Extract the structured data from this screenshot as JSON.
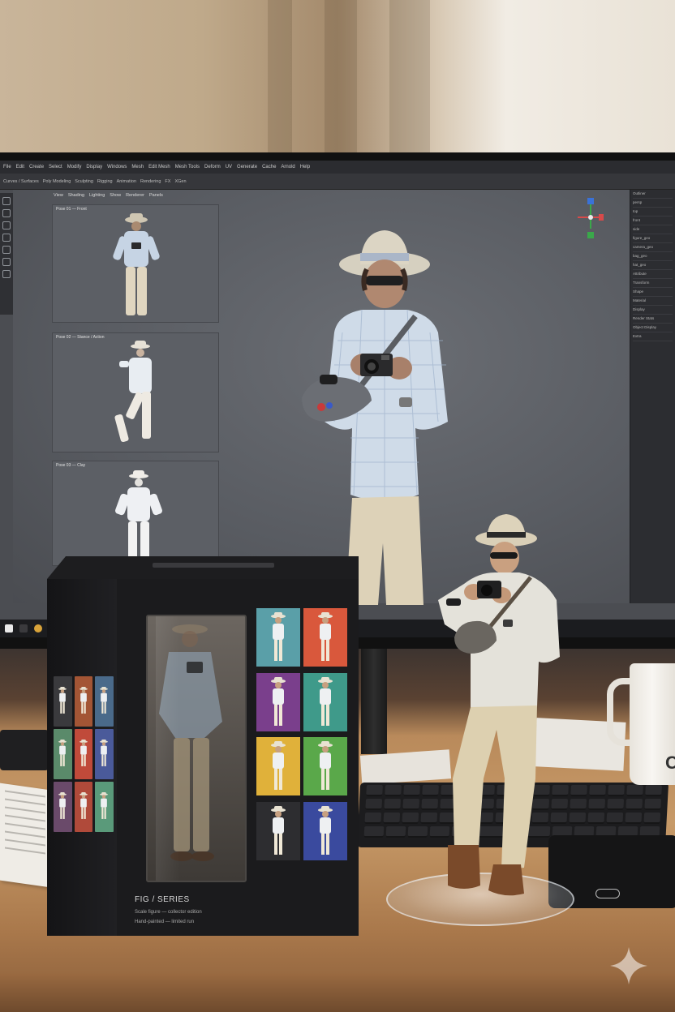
{
  "scene": {
    "description_kind": "photo",
    "mug_text": "C"
  },
  "monitor": {
    "menubar_items": [
      "File",
      "Edit",
      "Create",
      "Select",
      "Modify",
      "Display",
      "Windows",
      "Mesh",
      "Edit Mesh",
      "Mesh Tools",
      "Deform",
      "UV",
      "Generate",
      "Cache",
      "Arnold",
      "Help"
    ],
    "toolbar_items": [
      "Curves / Surfaces",
      "Poly Modeling",
      "Sculpting",
      "Rigging",
      "Animation",
      "Rendering",
      "FX",
      "XGen"
    ],
    "viewport_header": [
      "View",
      "Shading",
      "Lighting",
      "Show",
      "Renderer",
      "Panels"
    ],
    "thumbnails": [
      {
        "label": "Pose 01 — Front"
      },
      {
        "label": "Pose 02 — Stance / Action"
      },
      {
        "label": "Pose 03 — Clay"
      }
    ],
    "right_panel_rows": [
      "Outliner",
      "persp",
      "top",
      "front",
      "side",
      "figure_geo",
      "camera_geo",
      "bag_geo",
      "hat_geo",
      "Attribute",
      "Transform",
      "Shape",
      "Material",
      "Display",
      "Render Stats",
      "Object Display",
      "Extra"
    ]
  },
  "box": {
    "title": "FIG / SERIES",
    "lines": [
      "Scale figure — collector edition",
      "Hand-painted — limited run"
    ],
    "tile_colors": [
      "#5a9fa8",
      "#d9583c",
      "#7a3f8c",
      "#3f9a8a",
      "#e0b13a",
      "#5aa84a",
      "#2d2d30",
      "#3a4a9e"
    ],
    "side_colors": [
      "#3a3a3d",
      "#a35535",
      "#4a6a8a",
      "#5a8a6a",
      "#c04a3a",
      "#4a5a9a",
      "#6a4a6a",
      "#b04a3a",
      "#5a9a7a"
    ]
  },
  "colors": {
    "wall": "#c9b59a",
    "screen_bg": "#4b4d52",
    "desk": "#c79a68",
    "shirt": "#cfdbe8",
    "pants": "#ddd2b8",
    "hat": "#d9cfb7"
  }
}
